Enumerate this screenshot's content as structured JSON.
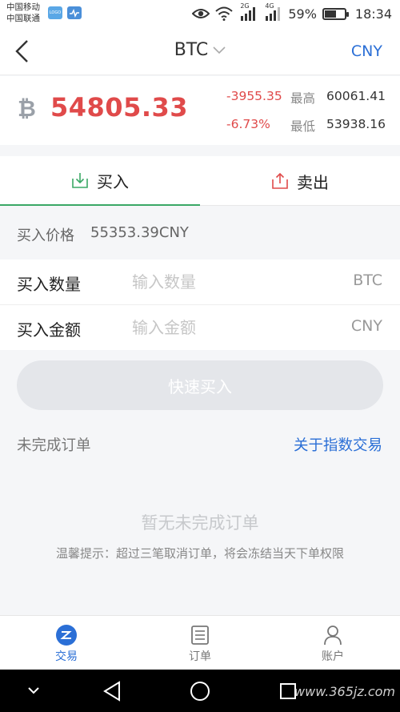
{
  "status_bar": {
    "carrier1": "中国移动",
    "carrier2": "中国联通",
    "app_badge": "LOGO",
    "net2g": "2G",
    "net4g": "4G",
    "battery_pct": "59%",
    "battery_level": 0.59,
    "time": "18:34"
  },
  "navbar": {
    "coin": "BTC",
    "currency": "CNY"
  },
  "ticker": {
    "price": "54805.33",
    "change_abs": "-3955.35",
    "change_pct": "-6.73%",
    "high_label": "最高",
    "high": "60061.41",
    "low_label": "最低",
    "low": "53938.16",
    "icon_glyph": "₿"
  },
  "tabs": {
    "buy": "买入",
    "sell": "卖出"
  },
  "buy_price": {
    "label": "买入价格",
    "value": "55353.39CNY"
  },
  "fields": {
    "quantity": {
      "label": "买入数量",
      "placeholder": "输入数量",
      "unit": "BTC"
    },
    "amount": {
      "label": "买入金额",
      "placeholder": "输入金额",
      "unit": "CNY"
    }
  },
  "quick_buy": "快速买入",
  "orders": {
    "title": "未完成订单",
    "link": "关于指数交易",
    "empty": "暂无未完成订单",
    "tip": "温馨提示：超过三笔取消订单，将会冻结当天下单权限"
  },
  "bottom_nav": [
    {
      "label": "交易",
      "icon": "trade-icon"
    },
    {
      "label": "订单",
      "icon": "orders-icon"
    },
    {
      "label": "账户",
      "icon": "account-icon"
    }
  ],
  "watermark": "www.365jz.com",
  "colors": {
    "accent": "#2b6fd6",
    "down_red": "#e04a4a",
    "buy_green": "#3aa866"
  }
}
